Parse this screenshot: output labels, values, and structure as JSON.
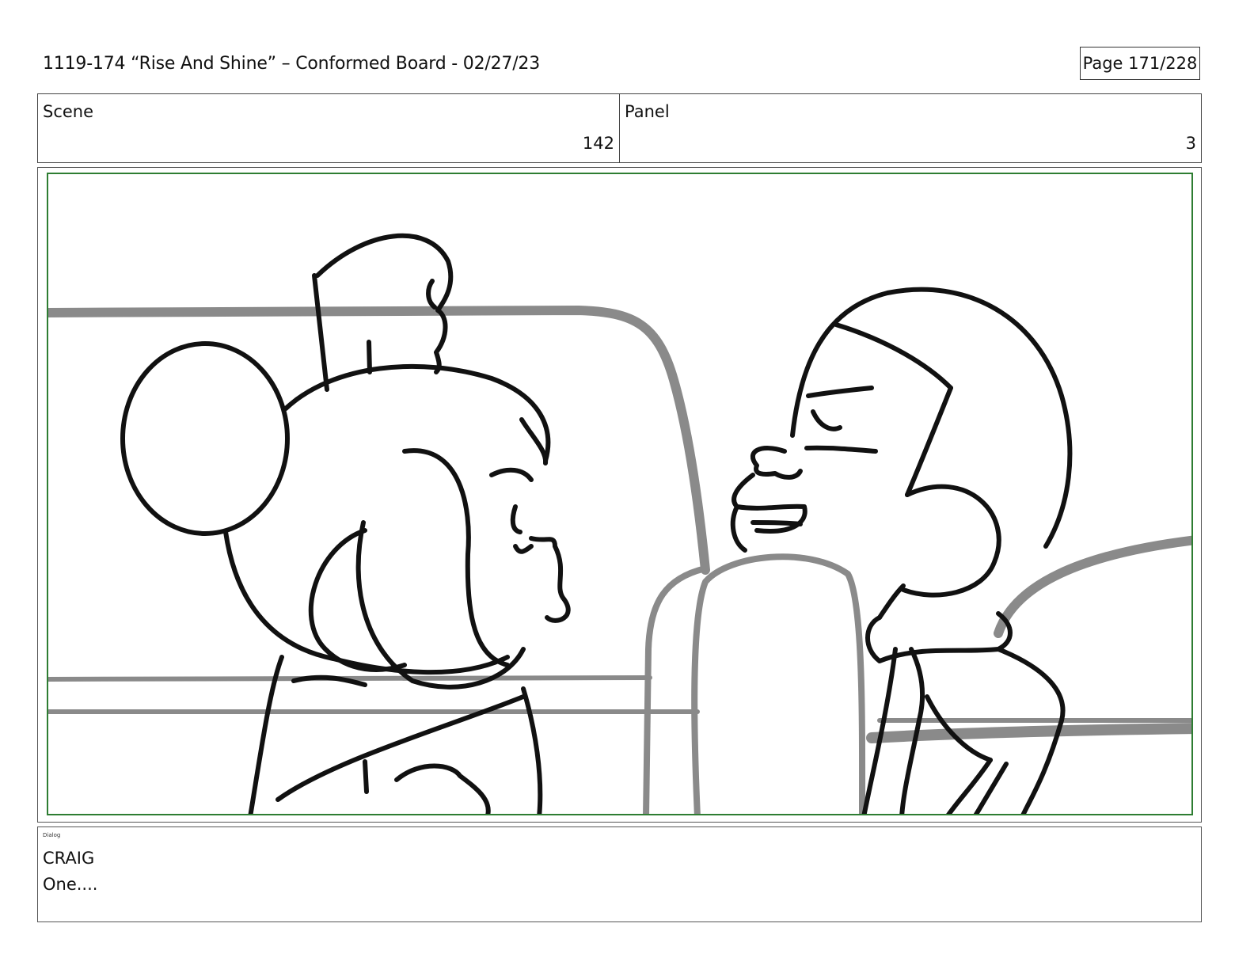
{
  "header": {
    "title": "1119-174 “Rise And Shine” – Conformed Board - 02/27/23",
    "page": "Page 171/228"
  },
  "info": {
    "scene_label": "Scene",
    "scene_value": "142",
    "panel_label": "Panel",
    "panel_value": "3"
  },
  "panel": {
    "safe_frame_color": "#2e7d32"
  },
  "dialog": {
    "label": "Dialog",
    "speaker": "CRAIG",
    "line": "One...."
  }
}
